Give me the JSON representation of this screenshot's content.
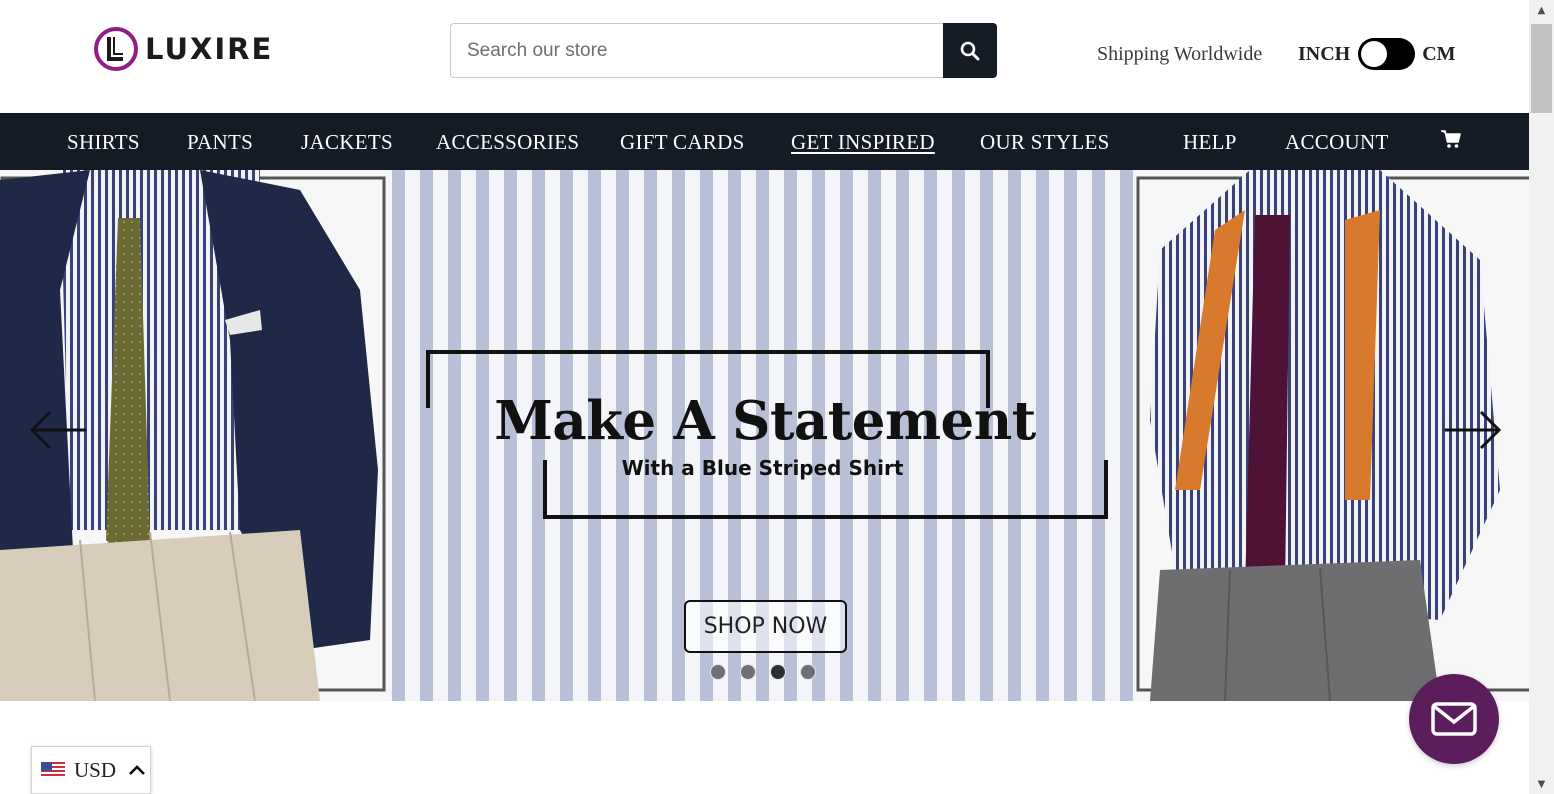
{
  "header": {
    "logo_text": "LUXIRE",
    "search": {
      "placeholder": "Search our store",
      "value": "",
      "button_icon": "search-icon"
    },
    "shipping_text": "Shipping Worldwide",
    "unit_toggle": {
      "left_label": "INCH",
      "right_label": "CM",
      "selected": "INCH"
    }
  },
  "nav": {
    "items": [
      {
        "label": "SHIRTS"
      },
      {
        "label": "PANTS"
      },
      {
        "label": "JACKETS"
      },
      {
        "label": "ACCESSORIES"
      },
      {
        "label": "GIFT CARDS"
      },
      {
        "label": "GET INSPIRED",
        "active": true
      },
      {
        "label": "OUR STYLES"
      },
      {
        "label": "HELP"
      },
      {
        "label": "ACCOUNT"
      }
    ],
    "cart_icon": "cart-icon"
  },
  "hero": {
    "title": "Make A Statement",
    "subtitle": "With a Blue Striped Shirt",
    "cta_label": "SHOP NOW",
    "prev_icon": "arrow-left-icon",
    "next_icon": "arrow-right-icon",
    "slide_count": 4,
    "active_slide_index": 2
  },
  "currency": {
    "code": "USD",
    "flag_icon": "us-flag-icon",
    "chevron_icon": "chevron-up-icon"
  },
  "chat": {
    "icon": "mail-icon"
  },
  "colors": {
    "nav_bg": "#151b24",
    "brand_purple": "#8e1f86",
    "chat_bg": "#5b1d5c",
    "stripe": "#b7bdd6"
  }
}
